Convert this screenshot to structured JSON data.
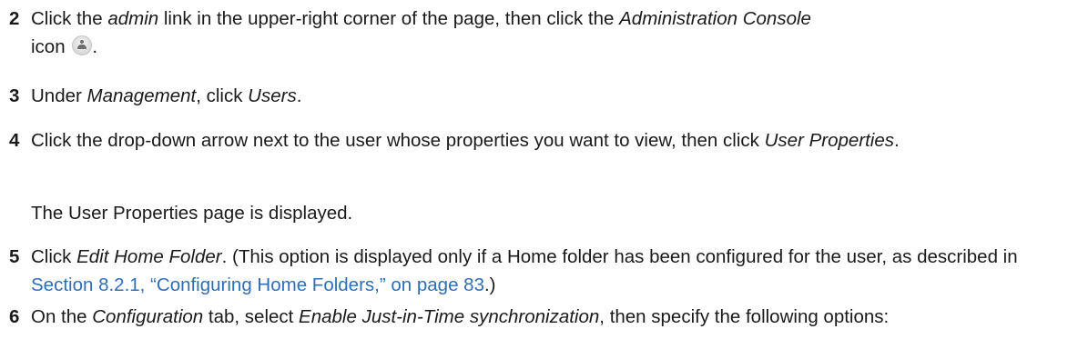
{
  "steps": [
    {
      "num": "2",
      "parts": [
        {
          "t": "Click the "
        },
        {
          "t": "admin",
          "em": true
        },
        {
          "t": " link in the upper-right corner of the page, then click the "
        },
        {
          "t": "Administration Console",
          "em": true
        }
      ],
      "line2_text": "icon",
      "line2_end": "."
    },
    {
      "num": "3",
      "parts": [
        {
          "t": "Under "
        },
        {
          "t": "Management",
          "em": true
        },
        {
          "t": ", click "
        },
        {
          "t": "Users",
          "em": true
        },
        {
          "t": "."
        }
      ]
    },
    {
      "num": "4",
      "parts": [
        {
          "t": "Click the drop-down arrow next to the user whose properties you want to view, then click "
        },
        {
          "t": "User Properties",
          "em": true
        },
        {
          "t": "."
        }
      ]
    },
    {
      "num": "5",
      "parts": [
        {
          "t": "Click "
        },
        {
          "t": "Edit Home Folder",
          "em": true
        },
        {
          "t": ". (This option is displayed only if a Home folder has been configured for the user, as described in "
        },
        {
          "t": "Section 8.2.1, “Configuring Home Folders,” on page 83",
          "link": true
        },
        {
          "t": ".)"
        }
      ]
    },
    {
      "num": "6",
      "parts": [
        {
          "t": "On the "
        },
        {
          "t": "Configuration",
          "em": true
        },
        {
          "t": " tab, select "
        },
        {
          "t": "Enable Just-in-Time synchronization",
          "em": true
        },
        {
          "t": ", then specify the following options:"
        }
      ]
    }
  ],
  "note_after_step_4": "The User Properties page is displayed.",
  "icons": {
    "administration_console": "user-silhouette-icon"
  },
  "colors": {
    "link": "#2f6fb7",
    "text": "#1a1a1a"
  }
}
